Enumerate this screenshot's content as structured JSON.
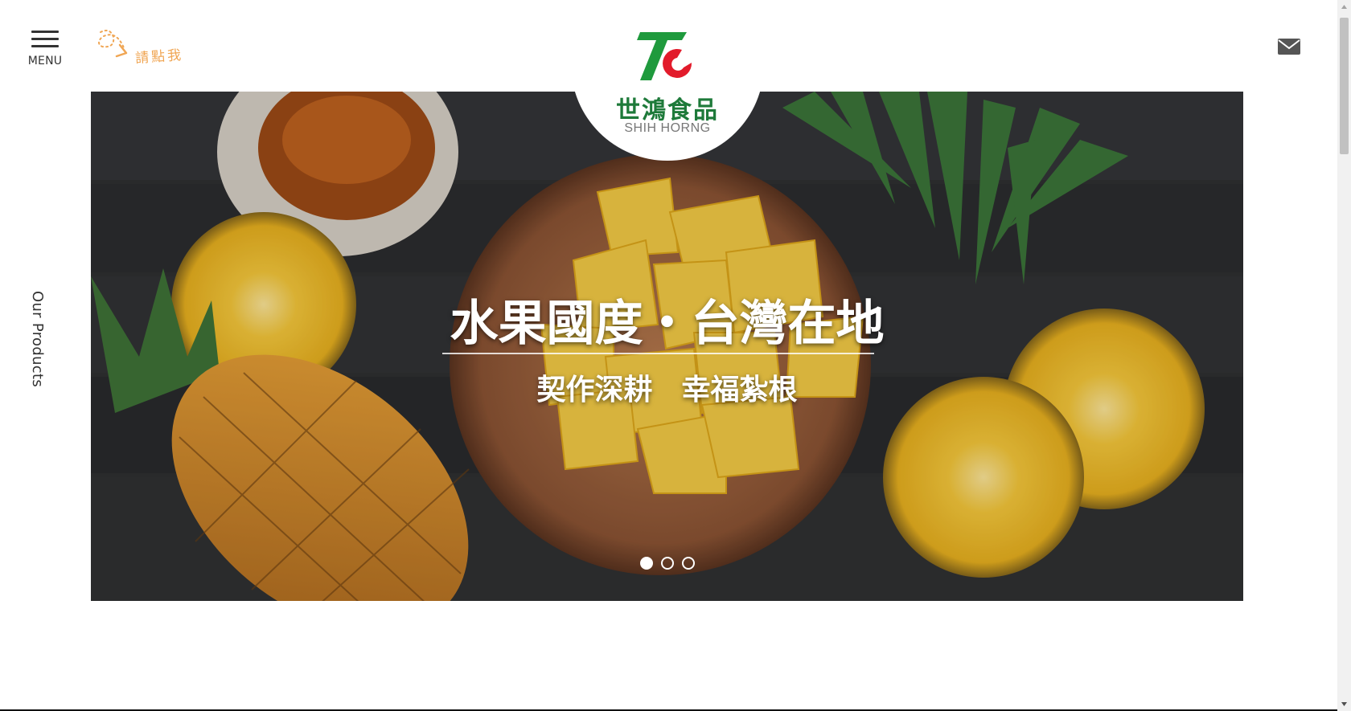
{
  "header": {
    "menu_label": "MENU",
    "click_hint": "請點我",
    "mail_icon": "envelope-icon"
  },
  "logo": {
    "chinese_name": "世鴻食品",
    "english_name": "SHIH HORNG",
    "brand_colors": {
      "green": "#1f9a3d",
      "red": "#e21b2b"
    }
  },
  "sidebar": {
    "label": "Our Products"
  },
  "banner": {
    "title": "水果國度・台灣在地",
    "subtitle": "契作深耕　幸福紮根",
    "slides_total": 3,
    "active_slide": 1
  }
}
